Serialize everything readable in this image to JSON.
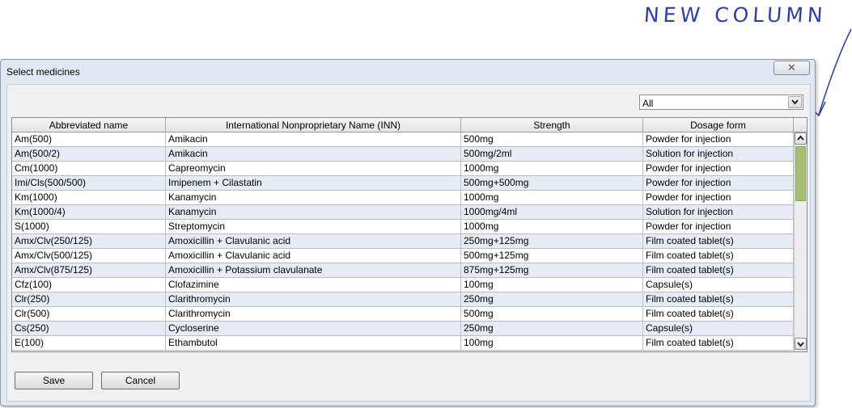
{
  "annotation": {
    "text": "NEW COLUMN"
  },
  "dialog": {
    "title": "Select medicines",
    "close_label": "✕",
    "filter": {
      "value": "All"
    },
    "columns": [
      "Abbreviated name",
      "International Nonproprietary Name (INN)",
      "Strength",
      "Dosage form",
      ""
    ],
    "rows": [
      [
        "Am(500)",
        "Amikacin",
        "500mg",
        "Powder for injection"
      ],
      [
        "Am(500/2)",
        "Amikacin",
        "500mg/2ml",
        "Solution for injection"
      ],
      [
        "Cm(1000)",
        "Capreomycin",
        "1000mg",
        "Powder for injection"
      ],
      [
        "Imi/Cls(500/500)",
        "Imipenem + Cilastatin",
        "500mg+500mg",
        "Powder for injection"
      ],
      [
        "Km(1000)",
        "Kanamycin",
        "1000mg",
        "Powder for injection"
      ],
      [
        "Km(1000/4)",
        "Kanamycin",
        "1000mg/4ml",
        "Solution for injection"
      ],
      [
        "S(1000)",
        "Streptomycin",
        "1000mg",
        "Powder for injection"
      ],
      [
        "Amx/Clv(250/125)",
        "Amoxicillin + Clavulanic acid",
        "250mg+125mg",
        "Film coated tablet(s)"
      ],
      [
        "Amx/Clv(500/125)",
        "Amoxicillin + Clavulanic acid",
        "500mg+125mg",
        "Film coated tablet(s)"
      ],
      [
        "Amx/Clv(875/125)",
        "Amoxicillin + Potassium clavulanate",
        "875mg+125mg",
        "Film coated tablet(s)"
      ],
      [
        "Cfz(100)",
        "Clofazimine",
        "100mg",
        "Capsule(s)"
      ],
      [
        "Clr(250)",
        "Clarithromycin",
        "250mg",
        "Film coated tablet(s)"
      ],
      [
        "Clr(500)",
        "Clarithromycin",
        "500mg",
        "Film coated tablet(s)"
      ],
      [
        "Cs(250)",
        "Cycloserine",
        "250mg",
        "Capsule(s)"
      ],
      [
        "E(100)",
        "Ethambutol",
        "100mg",
        "Film coated tablet(s)"
      ]
    ],
    "save_label": "Save",
    "cancel_label": "Cancel"
  },
  "colors": {
    "annotation": "#2b3fae",
    "alt_row": "#e6ecf5",
    "scroll_thumb": "#a6bf72"
  },
  "icons": [
    "close-icon",
    "chevron-down-icon",
    "scroll-up-icon",
    "scroll-down-icon",
    "arrow-annotation-icon"
  ]
}
